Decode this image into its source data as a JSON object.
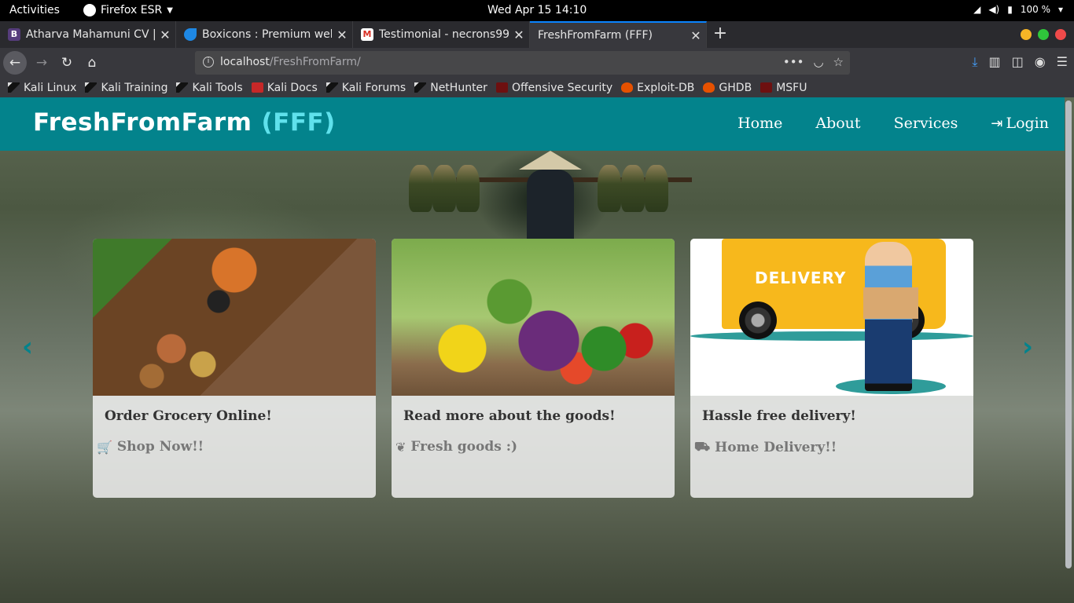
{
  "os": {
    "activities": "Activities",
    "app_name": "Firefox ESR",
    "clock": "Wed Apr 15  14:10",
    "battery": "100 %"
  },
  "tabs": [
    {
      "label": "Atharva Mahamuni CV | F",
      "favicon": "B",
      "favicon_color": "#563d7c"
    },
    {
      "label": "Boxicons : Premium web",
      "favicon": "",
      "favicon_color": "#1e88e5"
    },
    {
      "label": "Testimonial - necrons99",
      "favicon": "M",
      "favicon_color": "#d93025"
    },
    {
      "label": "FreshFromFarm (FFF)",
      "favicon": "",
      "favicon_color": "transparent",
      "active": true
    }
  ],
  "url": {
    "host": "localhost",
    "path": "/FreshFromFarm/"
  },
  "bookmarks": [
    {
      "label": "Kali Linux",
      "icon": "dragon"
    },
    {
      "label": "Kali Training",
      "icon": "dragon"
    },
    {
      "label": "Kali Tools",
      "icon": "dragon"
    },
    {
      "label": "Kali Docs",
      "icon": "docs"
    },
    {
      "label": "Kali Forums",
      "icon": "dragon"
    },
    {
      "label": "NetHunter",
      "icon": "dragon"
    },
    {
      "label": "Offensive Security",
      "icon": "os"
    },
    {
      "label": "Exploit-DB",
      "icon": "fire"
    },
    {
      "label": "GHDB",
      "icon": "fire"
    },
    {
      "label": "MSFU",
      "icon": "os"
    }
  ],
  "site": {
    "brand": "FreshFromFarm",
    "brand_abbr": "(FFF)",
    "nav": {
      "home": "Home",
      "about": "About",
      "services": "Services",
      "login": "Login"
    },
    "cards": [
      {
        "title": "Order Grocery Online!",
        "sub": "Shop Now!!",
        "icon": "cart-icon"
      },
      {
        "title": "Read more about the goods!",
        "sub": "Fresh goods :)",
        "icon": "leaf-icon"
      },
      {
        "title": "Hassle free delivery!",
        "sub": "Home Delivery!!",
        "icon": "truck-icon"
      }
    ],
    "delivery_image_text": "DELIVERY"
  },
  "colors": {
    "header": "#03838c",
    "brand_accent": "#5fe1ec"
  }
}
